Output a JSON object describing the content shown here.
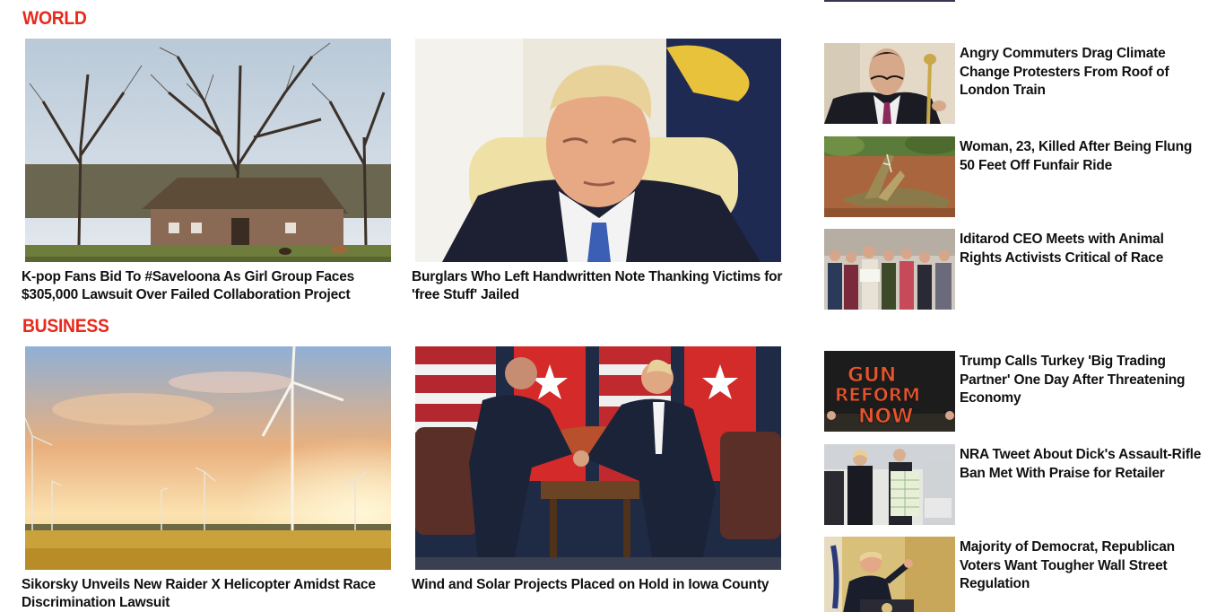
{
  "sections": {
    "world": {
      "label": "WORLD"
    },
    "business": {
      "label": "BUSINESS"
    }
  },
  "cards": {
    "world1": {
      "title": "K-pop Fans Bid To #Saveloona As Girl Group Faces $305,000 Lawsuit Over Failed Collaboration Project",
      "image": "farmhouse-with-bare-trees"
    },
    "world2": {
      "title": "Burglars Who Left Handwritten Note Thanking Victims for 'free Stuff' Jailed",
      "image": "man-in-suit-looking-down"
    },
    "business1": {
      "title": "Sikorsky Unveils New Raider X Helicopter Amidst Race Discrimination Lawsuit",
      "image": "wind-turbines-at-sunset"
    },
    "business2": {
      "title": "Wind and Solar Projects Placed on Hold in Iowa County",
      "image": "leaders-handshake-flags"
    }
  },
  "sidebar": {
    "items": [
      {
        "title": "Angry Commuters Drag Climate Change Protesters From Roof of London Train",
        "image": "man-with-mustache-and-cane"
      },
      {
        "title": "Woman, 23, Killed After Being Flung 50 Feet Off Funfair Ride",
        "image": "crocodile"
      },
      {
        "title": "Iditarod CEO Meets with Animal Rights Activists Critical of Race",
        "image": "crowd-of-protesters"
      },
      {
        "title": "Trump Calls Turkey 'Big Trading Partner' One Day After Threatening Economy",
        "image": "gun-reform-now-sign"
      },
      {
        "title": "NRA Tweet About Dick's Assault-Rifle Ban Met With Praise for Retailer",
        "image": "officials-holding-banknote-sheet"
      },
      {
        "title": "Majority of Democrat, Republican Voters Want Tougher Wall Street Regulation",
        "image": "speaker-at-podium"
      }
    ]
  },
  "colors": {
    "section_accent": "#e8291c",
    "headline_text": "#111111"
  }
}
